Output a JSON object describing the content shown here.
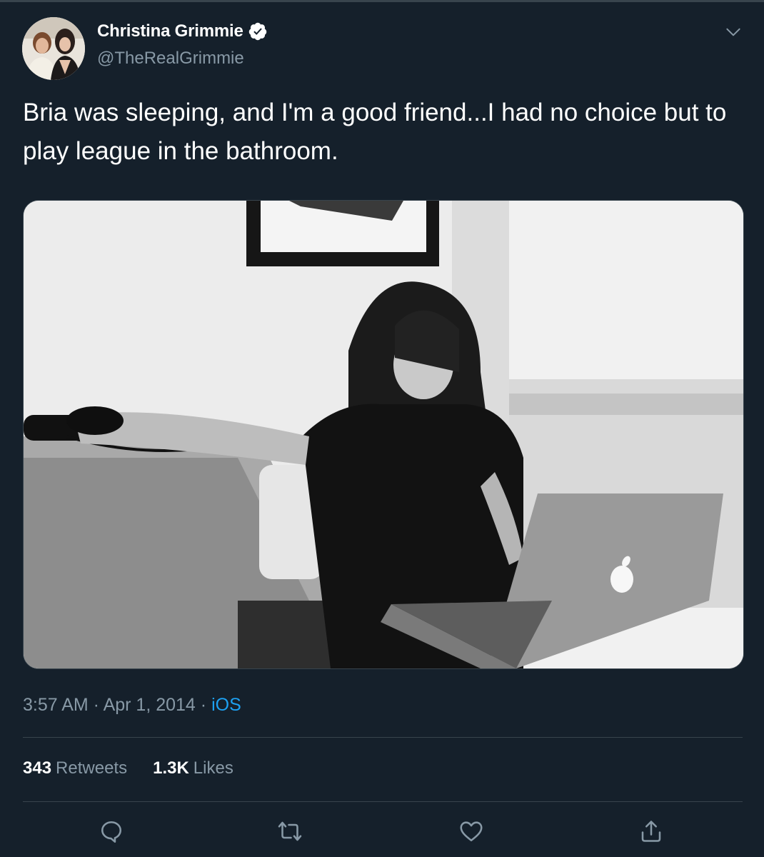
{
  "author": {
    "display_name": "Christina Grimmie",
    "handle": "@TheRealGrimmie",
    "verified": true
  },
  "tweet": {
    "text": "Bria was sleeping, and I'm a good friend...I had no choice but to play league in the bathroom."
  },
  "meta": {
    "time": "3:57 AM",
    "separator": " · ",
    "date": "Apr 1, 2014",
    "source": "iOS"
  },
  "stats": {
    "retweets_count": "343",
    "retweets_label": "Retweets",
    "likes_count": "1.3K",
    "likes_label": "Likes"
  },
  "icons": {
    "verified": "verified-badge-icon",
    "menu": "chevron-down-icon",
    "reply": "reply-icon",
    "retweet": "retweet-icon",
    "like": "heart-icon",
    "share": "share-icon"
  },
  "colors": {
    "background": "#15202b",
    "text_secondary": "#8899a6",
    "accent": "#1da1f2",
    "border": "#38444d"
  }
}
